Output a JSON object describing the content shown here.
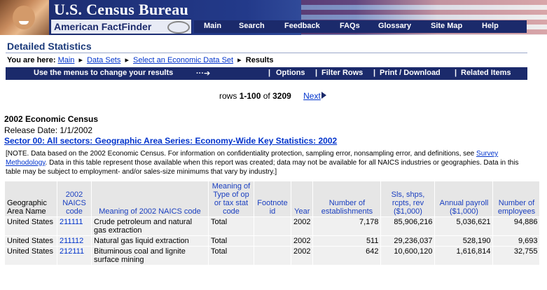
{
  "header": {
    "bureau_title": "U.S. Census Bureau",
    "aff_label": "American FactFinder",
    "nav": [
      "Main",
      "Search",
      "Feedback",
      "FAQs",
      "Glossary",
      "Site Map",
      "Help"
    ]
  },
  "page_title": "Detailed Statistics",
  "breadcrumb": {
    "prefix": "You are here:",
    "items": [
      "Main",
      "Data Sets",
      "Select an Economic Data Set"
    ],
    "current": "Results"
  },
  "menubar": {
    "lead": "Use the menus to change your results",
    "arrow": "···➔",
    "items": [
      "Options",
      "Filter Rows",
      "Print / Download",
      "Related Items"
    ]
  },
  "rows_info": {
    "prefix": "rows",
    "range": "1-100",
    "of": "of",
    "total": "3209",
    "next": "Next"
  },
  "census": {
    "title": "2002 Economic Census",
    "release": "Release Date: 1/1/2002",
    "sector": "Sector 00: All sectors: Geographic Area Series: Economy-Wide Key Statistics: 2002",
    "note_a": "[NOTE. Data based on the 2002 Economic Census. For information on confidentiality protection, sampling error, nonsampling error, and definitions, see",
    "note_link": "Survey Methodology",
    "note_b": ". Data in this table represent those available when this report was created; data may not be available for all NAICS industries or geographies. Data in this table may be subject to employment- and/or sales-size minimums that vary by industry.]"
  },
  "table": {
    "headers": [
      "Geographic Area Name",
      "2002 NAICS code",
      "Meaning of 2002 NAICS code",
      "Meaning of Type of op or tax stat code",
      "Footnote id",
      "Year",
      "Number of establishments",
      "Sls, shps, rcpts, rev ($1,000)",
      "Annual payroll ($1,000)",
      "Number of employees"
    ],
    "rows": [
      [
        "United States",
        "211111",
        "Crude petroleum and natural gas extraction",
        "Total",
        "",
        "2002",
        "7,178",
        "85,906,216",
        "5,036,621",
        "94,886"
      ],
      [
        "United States",
        "211112",
        "Natural gas liquid extraction",
        "Total",
        "",
        "2002",
        "511",
        "29,236,037",
        "528,190",
        "9,693"
      ],
      [
        "United States",
        "212111",
        "Bituminous coal and lignite surface mining",
        "Total",
        "",
        "2002",
        "642",
        "10,600,120",
        "1,616,814",
        "32,755"
      ]
    ]
  },
  "colors": {
    "navy": "#1b2a6b",
    "link": "#0033cc",
    "cell_bg": "#f0f0f0",
    "header_bg": "#e6e6e6"
  }
}
